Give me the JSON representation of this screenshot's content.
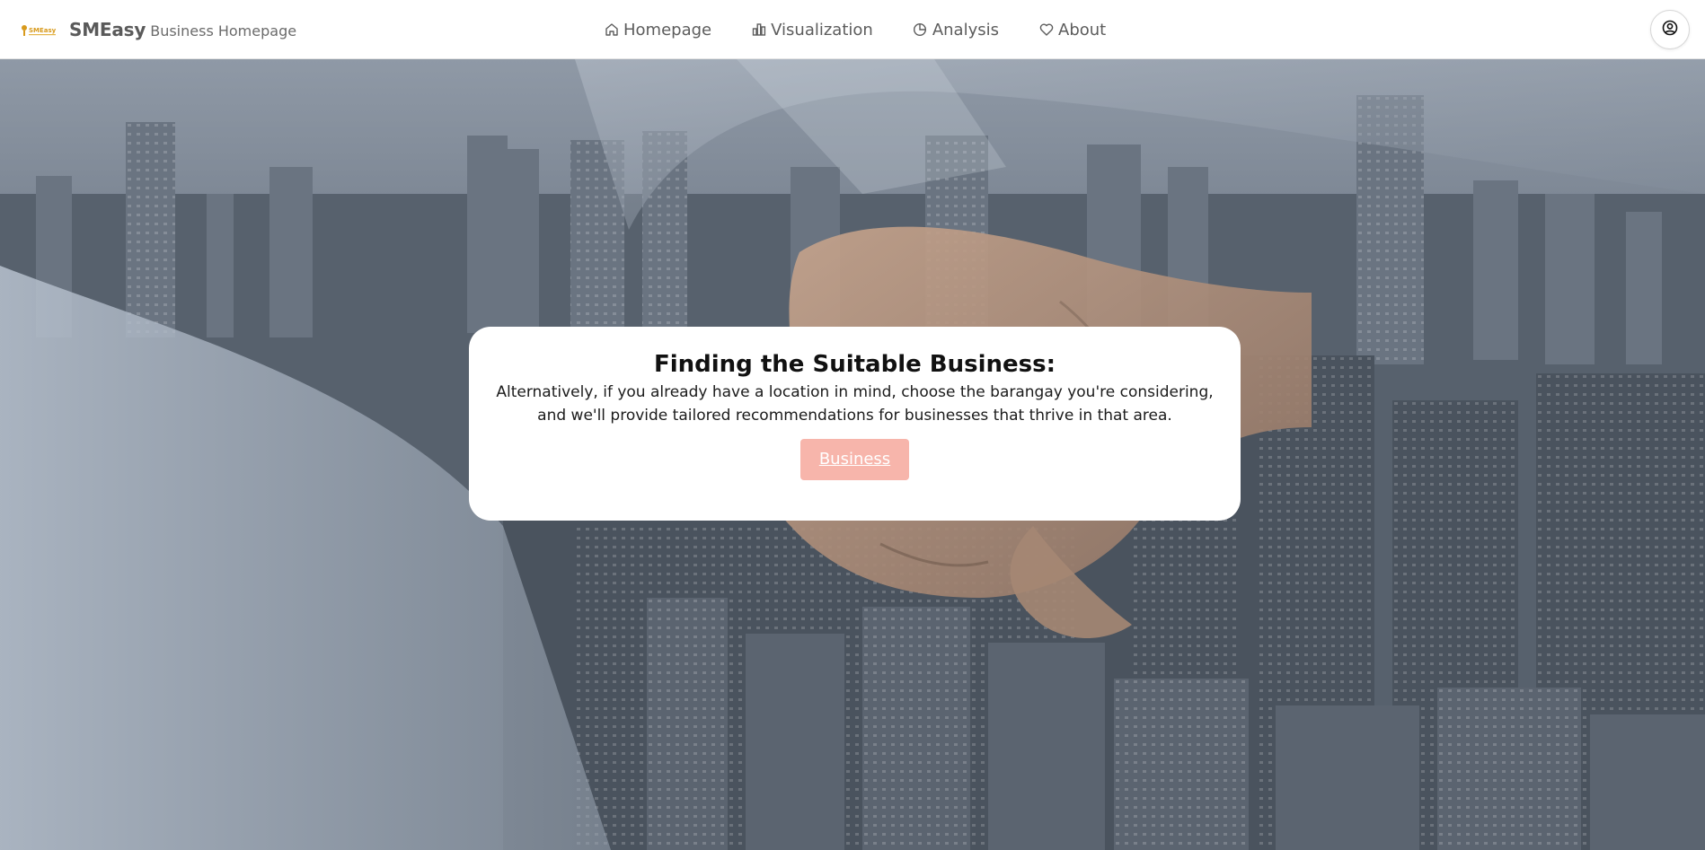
{
  "header": {
    "logo_text": "SMEasy",
    "brand_name": "SMEasy",
    "brand_subtitle": "Business Homepage",
    "nav": [
      {
        "label": "Homepage",
        "icon": "home-icon"
      },
      {
        "label": "Visualization",
        "icon": "bar-chart-icon"
      },
      {
        "label": "Analysis",
        "icon": "pie-chart-icon"
      },
      {
        "label": "About",
        "icon": "heart-icon"
      }
    ],
    "profile_icon": "user-circle-icon"
  },
  "hero": {
    "background": "city-skyline-handshake-photo",
    "card": {
      "title": "Finding the Suitable Business:",
      "line1": "Alternatively, if you already have a location in mind, choose the barangay you're considering,",
      "line2": "and we'll provide tailored recommendations for businesses that thrive in that area.",
      "button_label": "Business"
    }
  },
  "colors": {
    "button_bg": "#f7b5ab",
    "logo_accent": "#d89a1c",
    "nav_text": "#5c5c5c"
  }
}
